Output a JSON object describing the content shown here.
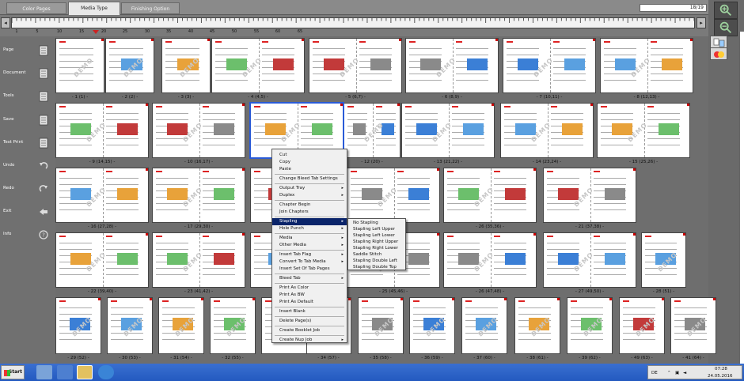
{
  "tabs": [
    {
      "label": "Color Pages",
      "active": false
    },
    {
      "label": "Media Type",
      "active": true
    },
    {
      "label": "Finishing Option",
      "active": false
    }
  ],
  "counter_value": "18/19",
  "ruler": {
    "labels": [
      "1",
      "5",
      "10",
      "15",
      "20",
      "25",
      "30",
      "35",
      "40",
      "45",
      "50",
      "55",
      "60",
      "65"
    ],
    "left_btn": "◂",
    "right_btn": "▸"
  },
  "sidebar": {
    "items": [
      {
        "label": "Page",
        "icon": "page-icon"
      },
      {
        "label": "Document",
        "icon": "document-icon"
      },
      {
        "label": "Tools",
        "icon": "tools-icon"
      },
      {
        "label": "Save",
        "icon": "save-icon"
      },
      {
        "label": "Test Print",
        "icon": "test-print-icon"
      },
      {
        "label": "Undo",
        "icon": "undo-icon"
      },
      {
        "label": "Redo",
        "icon": "redo-icon"
      },
      {
        "label": "Exit",
        "icon": "exit-icon"
      },
      {
        "label": "Info",
        "icon": "info-icon"
      }
    ]
  },
  "pages_row1": [
    "- 1 (1) -",
    "- 2 (2) -",
    "- 3 (3) -",
    "- 4 (4,5) -",
    "- 5 (6,7) -",
    "- 6 (8,9) -",
    "- 7 (10,11) -",
    "- 8 (12,13) -"
  ],
  "pages_row2": [
    "- 9 (14,15) -",
    "- 10 (16,17) -",
    "- 12 (20) -",
    "- 13 (21,22) -",
    "- 14 (23,24) -",
    "- 15 (25,26) -"
  ],
  "pages_row3": [
    "- 16 (27,28) -",
    "- 17 (29,30) -",
    "- 26 (35,36) -",
    "- 21 (37,38) -"
  ],
  "pages_row4": [
    "- 22 (39,40) -",
    "- 23 (41,42) -",
    "- 25 (45,46) -",
    "- 26 (47,48) -",
    "- 27 (49,50) -",
    "- 28 (51) -"
  ],
  "pages_row5": [
    "- 29 (52) -",
    "- 30 (53) -",
    "- 31 (54) -",
    "- 32 (55) -",
    "- 34 (57) -",
    "- 35 (58) -",
    "- 36 (59) -",
    "- 37 (60) -",
    "- 38 (61) -",
    "- 39 (62) -",
    "- 49 (63) -",
    "- 41 (64) -"
  ],
  "context_menu": [
    {
      "label": "Cut"
    },
    {
      "label": "Copy"
    },
    {
      "label": "Paste"
    },
    {
      "label": "Change Bleed Tab Settings"
    },
    {
      "label": "Output Tray",
      "sub": true
    },
    {
      "label": "Duplex",
      "sub": true
    },
    {
      "label": "Chapter Begin"
    },
    {
      "label": "Join Chapters"
    },
    {
      "label": "Stapling",
      "sub": true,
      "highlight": true
    },
    {
      "label": "Hole Punch",
      "sub": true
    },
    {
      "label": "Media",
      "sub": true
    },
    {
      "label": "Other Media",
      "sub": true
    },
    {
      "label": "Insert Tab Flag",
      "sub": true
    },
    {
      "label": "Convert To Tab Media",
      "sub": true
    },
    {
      "label": "Insert Set Of Tab Pages"
    },
    {
      "label": "Bleed Tab",
      "sub": true
    },
    {
      "label": "Print As Color"
    },
    {
      "label": "Print As BW"
    },
    {
      "label": "Print As Default"
    },
    {
      "label": "Insert Blank"
    },
    {
      "label": "Delete Page(s)"
    },
    {
      "label": "Create Booklet Job"
    },
    {
      "label": "Create Nup Job",
      "sub": true
    }
  ],
  "stapling_submenu": [
    "No Stapling",
    "Stapling Left Upper",
    "Stapling Left Lower",
    "Stapling Right Upper",
    "Stapling Right Lower",
    "Saddle Stitch",
    "Stapling Double Left",
    "Stapling Double Top"
  ],
  "watermark": "DEMO",
  "taskbar": {
    "start_label": "Start",
    "lang": "DE",
    "time": "07:28",
    "date": "24.05.2016"
  }
}
